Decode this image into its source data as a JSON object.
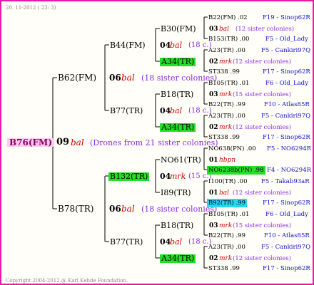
{
  "header": {
    "date": "20. 11-2012 ( 23:  3)"
  },
  "root": {
    "queen": "B76(FM)",
    "gen": "09",
    "breed": "bal",
    "note": "(Drones from 21 sister colonies)"
  },
  "g1": [
    {
      "queen": "B62(FM)",
      "gen": "06",
      "breed": "bal",
      "note": "(18 sister colonies)"
    },
    {
      "queen": "B78(TR)",
      "gen": "06",
      "breed": "bal",
      "note": "(18 sister colonies)"
    }
  ],
  "g2": [
    {
      "queen": "B44(FM)",
      "gen": "04",
      "breed": "bal",
      "note": "(18 c.)"
    },
    {
      "queen": "B77(TR)",
      "gen": "04",
      "breed": "bal",
      "note": "(18 c.)"
    },
    {
      "queen": "B132(TR)",
      "gen": "04",
      "breed": "mrk",
      "note": "(15 c.)"
    },
    {
      "queen": "B77(TR)",
      "gen": "04",
      "breed": "bal",
      "note": "(18 c.)"
    }
  ],
  "g3": [
    {
      "queen": "B30(FM)",
      "gen": "03",
      "breed": "bal",
      "note": "(12 sister colonies)"
    },
    {
      "queen": "A34(TR)",
      "gen": "02",
      "breed": "mrk",
      "note": "(12 sister colonies)"
    },
    {
      "queen": "B18(TR)",
      "gen": "03",
      "breed": "mrk",
      "note": "(15 sister colonies)"
    },
    {
      "queen": "A34(TR)",
      "gen": "02",
      "breed": "mrk",
      "note": "(12 sister colonies)"
    },
    {
      "queen": "NO61(TR)",
      "gen": "01",
      "breed": "hbpn",
      "note": ""
    },
    {
      "queen": "I89(TR)",
      "gen": "01",
      "breed": "bal",
      "note": "(12 sister colonies)"
    },
    {
      "queen": "B18(TR)",
      "gen": "03",
      "breed": "mrk",
      "note": "(15 sister colonies)"
    },
    {
      "queen": "A34(TR)",
      "gen": "02",
      "breed": "mrk",
      "note": "(12 sister colonies)"
    }
  ],
  "g4": [
    {
      "code": "B22(FM) .02",
      "ref": "F19 - Sinop62R"
    },
    {
      "code": "B153(TR) .00",
      "ref": "F5 - Old_Lady"
    },
    {
      "code": "A23(TR) .00",
      "ref": "F5 - Cankiri97Q"
    },
    {
      "code": "ST338 .99",
      "ref": "F17 - Sinop62R"
    },
    {
      "code": "B105(TR) .01",
      "ref": "F6 - Old_Lady"
    },
    {
      "code": "B22(TR) .99",
      "ref": "F10 - Atlas85R"
    },
    {
      "code": "A23(TR) .00",
      "ref": "F5 - Cankiri97Q"
    },
    {
      "code": "ST338 .99",
      "ref": "F17 - Sinop62R"
    },
    {
      "code": "NO638(PN) .00",
      "ref": "F5 - NO6294R"
    },
    {
      "code": "NO6238b(PN) .98",
      "ref": "F4 - NO6294R"
    },
    {
      "code": "I100(TR) .00",
      "ref": "F5 - Takab93aR"
    },
    {
      "code": "B92(TR) .99",
      "ref": "F17 - Sinop62R"
    },
    {
      "code": "B105(TR) .01",
      "ref": "F6 - Old_Lady"
    },
    {
      "code": "B22(TR) .99",
      "ref": "F10 - Atlas85R"
    },
    {
      "code": "A23(TR) .00",
      "ref": "F5 - Cankiri97Q"
    },
    {
      "code": "ST338 .99",
      "ref": "F17 - Sinop62R"
    }
  ],
  "footer": {
    "copyright": "Copyright 2004-2012 @ Karl Kehde Foundation."
  }
}
